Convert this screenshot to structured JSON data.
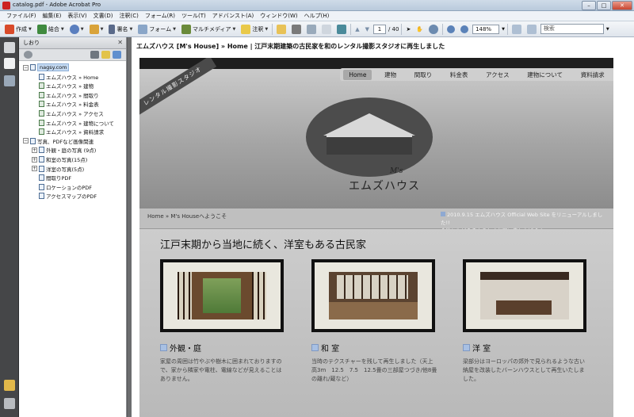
{
  "window": {
    "title": "catalog.pdf - Adobe Acrobat Pro",
    "min": "–",
    "max": "□",
    "close": "✕"
  },
  "menu": [
    "ファイル(F)",
    "編集(E)",
    "表示(V)",
    "文書(D)",
    "注釈(C)",
    "フォーム(R)",
    "ツール(T)",
    "アドバンスト(A)",
    "ウィンドウ(W)",
    "ヘルプ(H)"
  ],
  "toolbar": {
    "create": "作成",
    "combine": "結合",
    "sign": "署名",
    "forms": "フォーム",
    "multimedia": "マルチメディア",
    "comment": "注釈",
    "page_current": "1",
    "page_total": "/ 40",
    "zoom": "148%",
    "search_placeholder": "検索"
  },
  "bookmarks": {
    "header": "しおり",
    "close": "✕",
    "items": [
      {
        "label": "nagsy.com",
        "level": 0,
        "toggle": "−",
        "type": "page",
        "selected": true
      },
      {
        "label": "エムズハウス » Home",
        "level": 1,
        "toggle": "",
        "type": "page"
      },
      {
        "label": "エムズハウス » 建物",
        "level": 1,
        "toggle": "",
        "type": "img"
      },
      {
        "label": "エムズハウス » 間取り",
        "level": 1,
        "toggle": "",
        "type": "img"
      },
      {
        "label": "エムズハウス » 料金表",
        "level": 1,
        "toggle": "",
        "type": "img"
      },
      {
        "label": "エムズハウス » アクセス",
        "level": 1,
        "toggle": "",
        "type": "img"
      },
      {
        "label": "エムズハウス » 建物について",
        "level": 1,
        "toggle": "",
        "type": "img"
      },
      {
        "label": "エムズハウス » 資料請求",
        "level": 1,
        "toggle": "",
        "type": "img"
      },
      {
        "label": "写真、PDFなど画像関連",
        "level": 0,
        "toggle": "−",
        "type": "page"
      },
      {
        "label": "外観・庭の写真 (9点)",
        "level": 1,
        "toggle": "+",
        "type": "page"
      },
      {
        "label": "和室の写真(15点)",
        "level": 1,
        "toggle": "+",
        "type": "page"
      },
      {
        "label": "洋室の写真(5点)",
        "level": 1,
        "toggle": "+",
        "type": "page"
      },
      {
        "label": "間取りPDF",
        "level": 1,
        "toggle": "",
        "type": "page"
      },
      {
        "label": "ロケーションのPDF",
        "level": 1,
        "toggle": "",
        "type": "page"
      },
      {
        "label": "アクセスマップのPDF",
        "level": 1,
        "toggle": "",
        "type": "page"
      }
    ]
  },
  "page": {
    "title": "エムズハウス [M's House] » Home | 江戸末期建築の古民家を和のレンタル撮影スタジオに再生しました",
    "nav": [
      "Home",
      "建物",
      "間取り",
      "料金表",
      "アクセス",
      "建物について",
      "資料請求"
    ],
    "ribbon": "レンタル撮影スタジオ",
    "logo_main": "エムズハウス",
    "logo_sub": "M's",
    "breadcrumb": "Home » M's Houseへようこそ",
    "news_line1": "2010.9.15 エムズハウス Official Web Site をリニューアルしました!!",
    "news_line2": "今後ともどうぞよろしくお願い申し上げます。",
    "heading": "江戸末期から当地に続く、洋室もある古民家",
    "cards": [
      {
        "title": "外観・庭",
        "text": "家屋の周囲は竹やぶや樹木に囲まれておりますので、家から隣家や電柱、電線などが見えることはありません。"
      },
      {
        "title": "和 室",
        "text": "当時のテクスチャーを残して再生しました（天上高3m　12.5　7.5　12.5畳の三部屋つづき/他8畳の離れ/蔵など）"
      },
      {
        "title": "洋 室",
        "text": "梁部分はヨーロッパの郊外で見られるような古い納屋を改装したバーンハウスとして再生いたしました。"
      }
    ]
  }
}
